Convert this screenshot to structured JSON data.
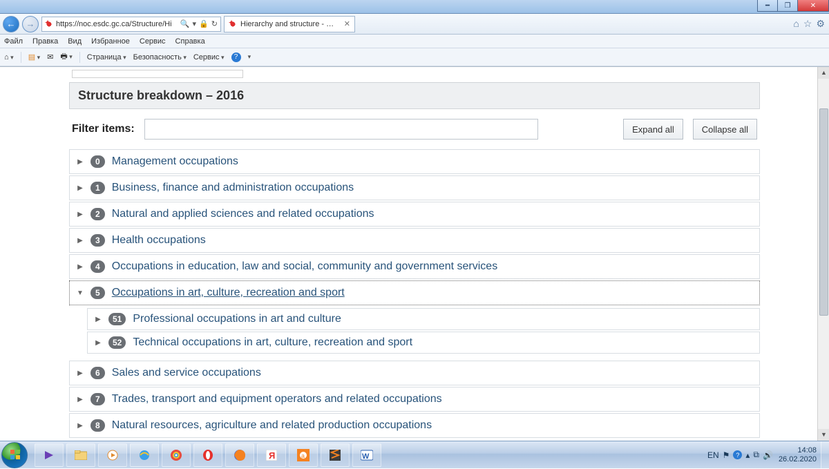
{
  "window": {
    "min_icon": "━",
    "max_icon": "❐",
    "close_icon": "✕"
  },
  "browser": {
    "url": "https://noc.esdc.gc.ca/Structure/Hi",
    "tab_title": "Hierarchy and structure - C...",
    "home_icon": "⌂",
    "star_icon": "☆",
    "gear_icon": "⚙",
    "search_icon": "🔍",
    "lock_icon": "🔒",
    "refresh_icon": "↻"
  },
  "menubar": {
    "items": [
      "Файл",
      "Правка",
      "Вид",
      "Избранное",
      "Сервис",
      "Справка"
    ]
  },
  "cmdbar": {
    "page": "Страница",
    "safety": "Безопасность",
    "service": "Сервис",
    "home": "⌂",
    "rss": "▤",
    "mail": "✉",
    "print": "🖶",
    "help": "?"
  },
  "page": {
    "section_title": "Structure breakdown – 2016",
    "filter_label": "Filter items:",
    "expand_all": "Expand all",
    "collapse_all": "Collapse all"
  },
  "tree": [
    {
      "code": "0",
      "label": "Management occupations",
      "expanded": false
    },
    {
      "code": "1",
      "label": "Business, finance and administration occupations",
      "expanded": false
    },
    {
      "code": "2",
      "label": "Natural and applied sciences and related occupations",
      "expanded": false
    },
    {
      "code": "3",
      "label": "Health occupations",
      "expanded": false
    },
    {
      "code": "4",
      "label": "Occupations in education, law and social, community and government services",
      "expanded": false
    },
    {
      "code": "5",
      "label": "Occupations in art, culture, recreation and sport",
      "expanded": true,
      "children": [
        {
          "code": "51",
          "label": "Professional occupations in art and culture"
        },
        {
          "code": "52",
          "label": "Technical occupations in art, culture, recreation and sport"
        }
      ]
    },
    {
      "code": "6",
      "label": "Sales and service occupations",
      "expanded": false
    },
    {
      "code": "7",
      "label": "Trades, transport and equipment operators and related occupations",
      "expanded": false
    },
    {
      "code": "8",
      "label": "Natural resources, agriculture and related production occupations",
      "expanded": false
    }
  ],
  "taskbar": {
    "lang": "EN",
    "time": "14:08",
    "date": "26.02.2020"
  }
}
